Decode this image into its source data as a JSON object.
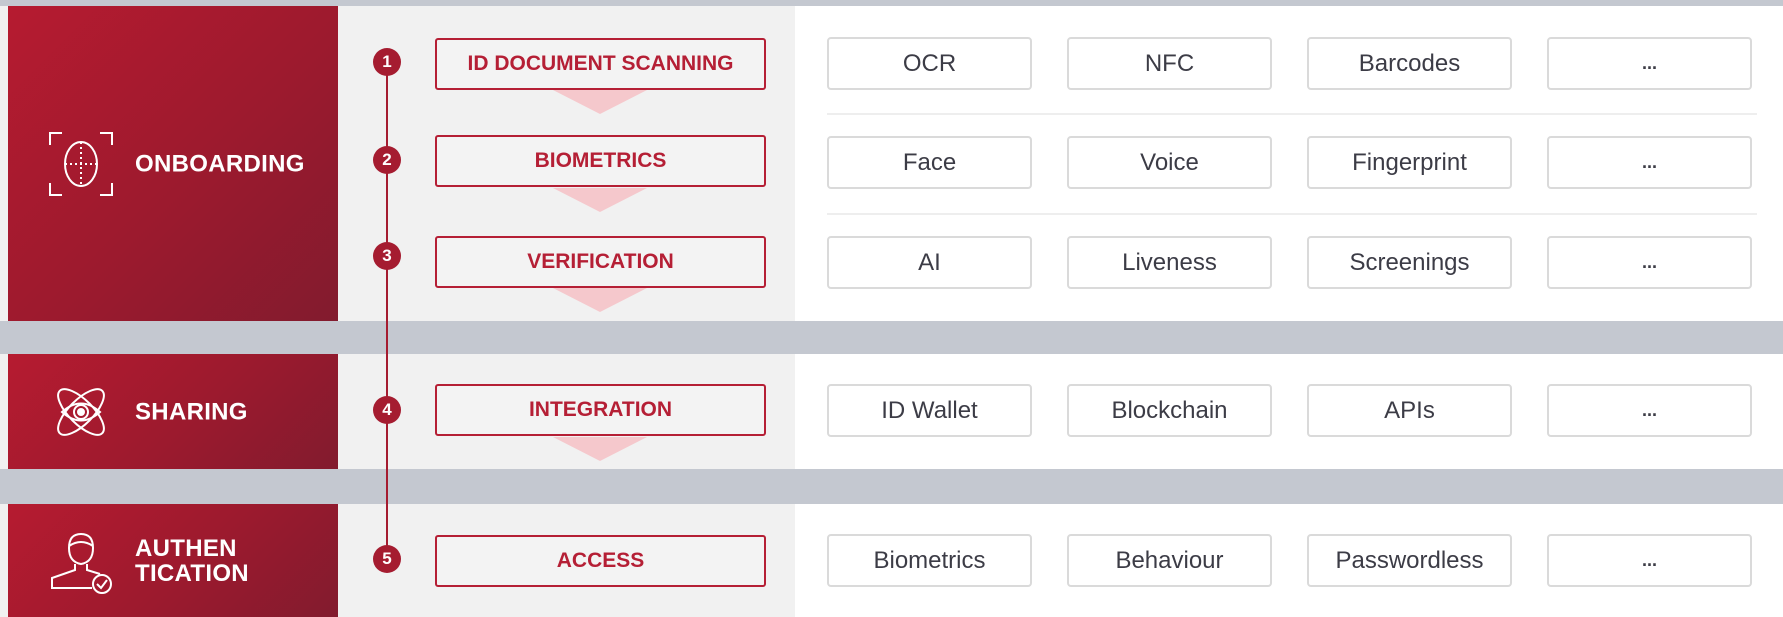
{
  "categories": {
    "onboarding": {
      "label": "ONBOARDING",
      "icon": "face-scan-icon"
    },
    "sharing": {
      "label": "SHARING",
      "icon": "eye-orbit-icon"
    },
    "authentication": {
      "label": "AUTHEN\nTICATION",
      "icon": "user-check-icon"
    }
  },
  "steps": [
    {
      "num": "1",
      "label": "ID DOCUMENT SCANNING",
      "options": [
        "OCR",
        "NFC",
        "Barcodes",
        "..."
      ]
    },
    {
      "num": "2",
      "label": "BIOMETRICS",
      "options": [
        "Face",
        "Voice",
        "Fingerprint",
        "..."
      ]
    },
    {
      "num": "3",
      "label": "VERIFICATION",
      "options": [
        "AI",
        "Liveness",
        "Screenings",
        "..."
      ]
    },
    {
      "num": "4",
      "label": "INTEGRATION",
      "options": [
        "ID Wallet",
        "Blockchain",
        "APIs",
        "..."
      ]
    },
    {
      "num": "5",
      "label": "ACCESS",
      "options": [
        "Biometrics",
        "Behaviour",
        "Passwordless",
        "..."
      ]
    }
  ],
  "colors": {
    "brand_red": "#a51c30",
    "step_arrow": "#f5c8cc",
    "background": "#c4c8d0"
  }
}
